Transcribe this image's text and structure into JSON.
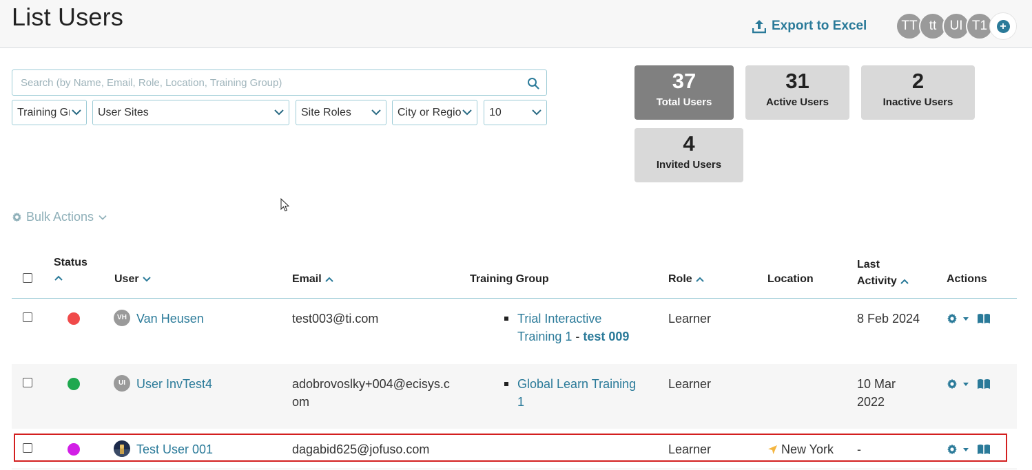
{
  "page": {
    "title": "List Users"
  },
  "toolbar": {
    "export_label": "Export to Excel"
  },
  "avatars": [
    "TT",
    "tt",
    "UI",
    "T1"
  ],
  "search": {
    "placeholder": "Search (by Name, Email, Role, Location, Training Group)",
    "value": ""
  },
  "filters": {
    "training_group": "Training Gr",
    "user_sites": "User Sites",
    "site_roles": "Site Roles",
    "city_region": "City or Regior",
    "page_size": "10"
  },
  "stats": [
    {
      "value": "37",
      "label": "Total Users"
    },
    {
      "value": "31",
      "label": "Active Users"
    },
    {
      "value": "2",
      "label": "Inactive Users"
    },
    {
      "value": "4",
      "label": "Invited Users"
    }
  ],
  "bulk_actions": {
    "label": "Bulk Actions"
  },
  "table": {
    "headers": {
      "status": "Status",
      "user": "User",
      "email": "Email",
      "training_group": "Training Group",
      "role": "Role",
      "location": "Location",
      "last_activity_1": "Last",
      "last_activity_2": "Activity",
      "actions": "Actions"
    },
    "rows": [
      {
        "status_color": "#f04a4a",
        "initials": "VH",
        "name": "Van Heusen",
        "email": "test003@ti.com",
        "email_2": "",
        "group_line1": "Trial Interactive",
        "group_line2": "Training 1",
        "group_sep": " - ",
        "group_bold": "test 009",
        "role": "Learner",
        "location": "",
        "last_activity_1": "8 Feb 2024",
        "last_activity_2": ""
      },
      {
        "status_color": "#1fa84f",
        "initials": "UI",
        "name": "User InvTest4",
        "email": "adobrovoslky+004@ecisys.c",
        "email_2": "om",
        "group_line1": "Global Learn Training",
        "group_line2": "1",
        "group_sep": "",
        "group_bold": "",
        "role": "Learner",
        "location": "",
        "last_activity_1": "10 Mar",
        "last_activity_2": "2022"
      },
      {
        "status_color": "#d21fe6",
        "initials": "",
        "name": "Test User 001",
        "email": "dagabid625@jofuso.com",
        "email_2": "",
        "group_line1": "",
        "group_line2": "",
        "group_sep": "",
        "group_bold": "",
        "role": "Learner",
        "location": "New York",
        "last_activity_1": "-",
        "last_activity_2": ""
      }
    ]
  },
  "colors": {
    "accent": "#2a7a99",
    "highlight": "#d31f1f",
    "card": "#d9d9d9",
    "card_active": "#808080"
  }
}
